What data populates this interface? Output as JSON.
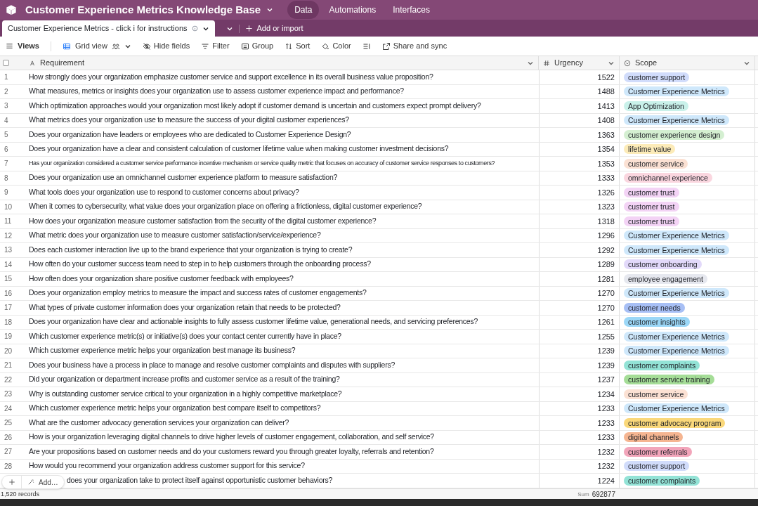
{
  "base": {
    "title": "Customer Experience Metrics Knowledge Base",
    "nav": [
      {
        "label": "Data",
        "selected": true
      },
      {
        "label": "Automations",
        "selected": false
      },
      {
        "label": "Interfaces",
        "selected": false
      }
    ]
  },
  "table_tab": {
    "label": "Customer Experience Metrics - click i for instructions",
    "add_label": "Add or import"
  },
  "toolbar": {
    "views": "Views",
    "view_name": "Grid view",
    "items": [
      {
        "kind": "hide",
        "label": "Hide fields"
      },
      {
        "kind": "filter",
        "label": "Filter"
      },
      {
        "kind": "group",
        "label": "Group"
      },
      {
        "kind": "sort",
        "label": "Sort"
      },
      {
        "kind": "color",
        "label": "Color"
      },
      {
        "kind": "height"
      },
      {
        "kind": "share",
        "label": "Share and sync"
      }
    ]
  },
  "table": {
    "select_all": {
      "checked": false
    },
    "columns": [
      "Requirement",
      "Urgency",
      "Scope"
    ],
    "rows": [
      {
        "number": "1",
        "requirement": "How strongly does your organization emphasize customer service and support excellence in its overall business value proposition?",
        "urgency": "1522",
        "scope": "customer support",
        "color": "#d1dcfb"
      },
      {
        "number": "2",
        "requirement": "What measures, metrics or insights does your organization use to assess customer experience impact and performance?",
        "urgency": "1488",
        "scope": "Customer Experience Metrics",
        "color": "#cfe8fb"
      },
      {
        "number": "3",
        "requirement": "Which optimization approaches would your organization most likely adopt if customer demand is uncertain and customers expect prompt delivery?",
        "urgency": "1413",
        "scope": "App Optimization",
        "color": "#c9f1ea"
      },
      {
        "number": "4",
        "requirement": "What metrics does your organization use to measure the success of your digital customer experiences?",
        "urgency": "1408",
        "scope": "Customer Experience Metrics",
        "color": "#cfe8fb"
      },
      {
        "number": "5",
        "requirement": "Does your organization have leaders or employees who are dedicated to Customer Experience Design?",
        "urgency": "1363",
        "scope": "customer experience design",
        "color": "#d4efd1"
      },
      {
        "number": "6",
        "requirement": "Does your organization have a clear and consistent calculation of customer lifetime value when making customer investment decisions?",
        "urgency": "1354",
        "scope": "lifetime value",
        "color": "#fcebb8"
      },
      {
        "number": "7",
        "requirement": "Has your organization considered a customer service performance incentive mechanism or service quality metric that focuses on accuracy of customer service responses to customers?",
        "urgency": "1353",
        "scope": "customer service",
        "color": "#fbe1d3"
      },
      {
        "number": "8",
        "requirement": "Does your organization use an omnichannel customer experience platform to measure satisfaction?",
        "urgency": "1333",
        "scope": "omnichannel experience",
        "color": "#fad6df"
      },
      {
        "number": "9",
        "requirement": "What tools does your organization use to respond to customer concerns about privacy?",
        "urgency": "1326",
        "scope": "customer trust",
        "color": "#f3d3f5"
      },
      {
        "number": "10",
        "requirement": "When it comes to cybersecurity, what value does your organization place on offering a frictionless, digital customer experience?",
        "urgency": "1323",
        "scope": "customer trust",
        "color": "#f3d3f5"
      },
      {
        "number": "11",
        "requirement": "How does your organization measure customer satisfaction from the security of the digital customer experience?",
        "urgency": "1318",
        "scope": "customer trust",
        "color": "#f3d3f5"
      },
      {
        "number": "12",
        "requirement": "What metric does your organization use to measure customer satisfaction/service/experience?",
        "urgency": "1296",
        "scope": "Customer Experience Metrics",
        "color": "#cfe8fb"
      },
      {
        "number": "13",
        "requirement": "Does each customer interaction live up to the brand experience that your organization is trying to create?",
        "urgency": "1292",
        "scope": "Customer Experience Metrics",
        "color": "#cfe8fb"
      },
      {
        "number": "14",
        "requirement": "How often do your customer success team need to step in to help customers through the onboarding process?",
        "urgency": "1289",
        "scope": "customer onboarding",
        "color": "#e2d9fa"
      },
      {
        "number": "15",
        "requirement": "How often does your organization share positive customer feedback with employees?",
        "urgency": "1281",
        "scope": "employee engagement",
        "color": "#e6e8ef"
      },
      {
        "number": "16",
        "requirement": "Does your organization employ metrics to measure the impact and success rates of customer engagements?",
        "urgency": "1270",
        "scope": "Customer Experience Metrics",
        "color": "#cfe8fb"
      },
      {
        "number": "17",
        "requirement": "What types of private customer information does your organization retain that needs to be protected?",
        "urgency": "1270",
        "scope": "customer needs",
        "color": "#a7bff5"
      },
      {
        "number": "18",
        "requirement": "Does your organization have clear and actionable insights to fully assess customer lifetime value, generational needs, and servicing preferences?",
        "urgency": "1261",
        "scope": "customer insights",
        "color": "#9bd7f7"
      },
      {
        "number": "19",
        "requirement": "Which customer experience metric(s) or initiative(s) does your contact center currently have in place?",
        "urgency": "1255",
        "scope": "Customer Experience Metrics",
        "color": "#cfe8fb"
      },
      {
        "number": "20",
        "requirement": "Which customer experience metric helps your organization best manage its business?",
        "urgency": "1239",
        "scope": "Customer Experience Metrics",
        "color": "#cfe8fb"
      },
      {
        "number": "21",
        "requirement": "Does your business have a process in place to manage and resolve customer complaints and disputes with suppliers?",
        "urgency": "1239",
        "scope": "customer complaints",
        "color": "#93e3d6"
      },
      {
        "number": "22",
        "requirement": "Did your organization or department increase profits and customer service as a result of the training?",
        "urgency": "1237",
        "scope": "customer service training",
        "color": "#a5dd97"
      },
      {
        "number": "23",
        "requirement": "Why is outstanding customer service critical to your organization in a highly competitive marketplace?",
        "urgency": "1234",
        "scope": "customer service",
        "color": "#fbe1d3"
      },
      {
        "number": "24",
        "requirement": "Which customer experience metric helps your organization best compare itself to competitors?",
        "urgency": "1233",
        "scope": "Customer Experience Metrics",
        "color": "#cfe8fb"
      },
      {
        "number": "25",
        "requirement": "What are the customer advocacy generation services your organization can deliver?",
        "urgency": "1233",
        "scope": "customer advocacy program",
        "color": "#fad87a"
      },
      {
        "number": "26",
        "requirement": "How is your organization leveraging digital channels to drive higher levels of customer engagement, collaboration, and self service?",
        "urgency": "1233",
        "scope": "digital channels",
        "color": "#f5b591"
      },
      {
        "number": "27",
        "requirement": "Are your propositions based on customer needs and do your customers reward you through greater loyalty, referrals and retention?",
        "urgency": "1232",
        "scope": "customer referrals",
        "color": "#f2a5ba"
      },
      {
        "number": "28",
        "requirement": "How would you recommend your organization address customer support for this service?",
        "urgency": "1232",
        "scope": "customer support",
        "color": "#d1dcfb"
      },
      {
        "requirement": "does your organization take to protect itself against opportunistic customer behaviors?",
        "urgency": "1224",
        "scope": "customer complaints",
        "color": "#93e3d6"
      }
    ]
  },
  "add_bar": {
    "label": "Add…"
  },
  "footer": {
    "records": "1,520 records",
    "sum_label": "Sum",
    "sum": "692877"
  }
}
